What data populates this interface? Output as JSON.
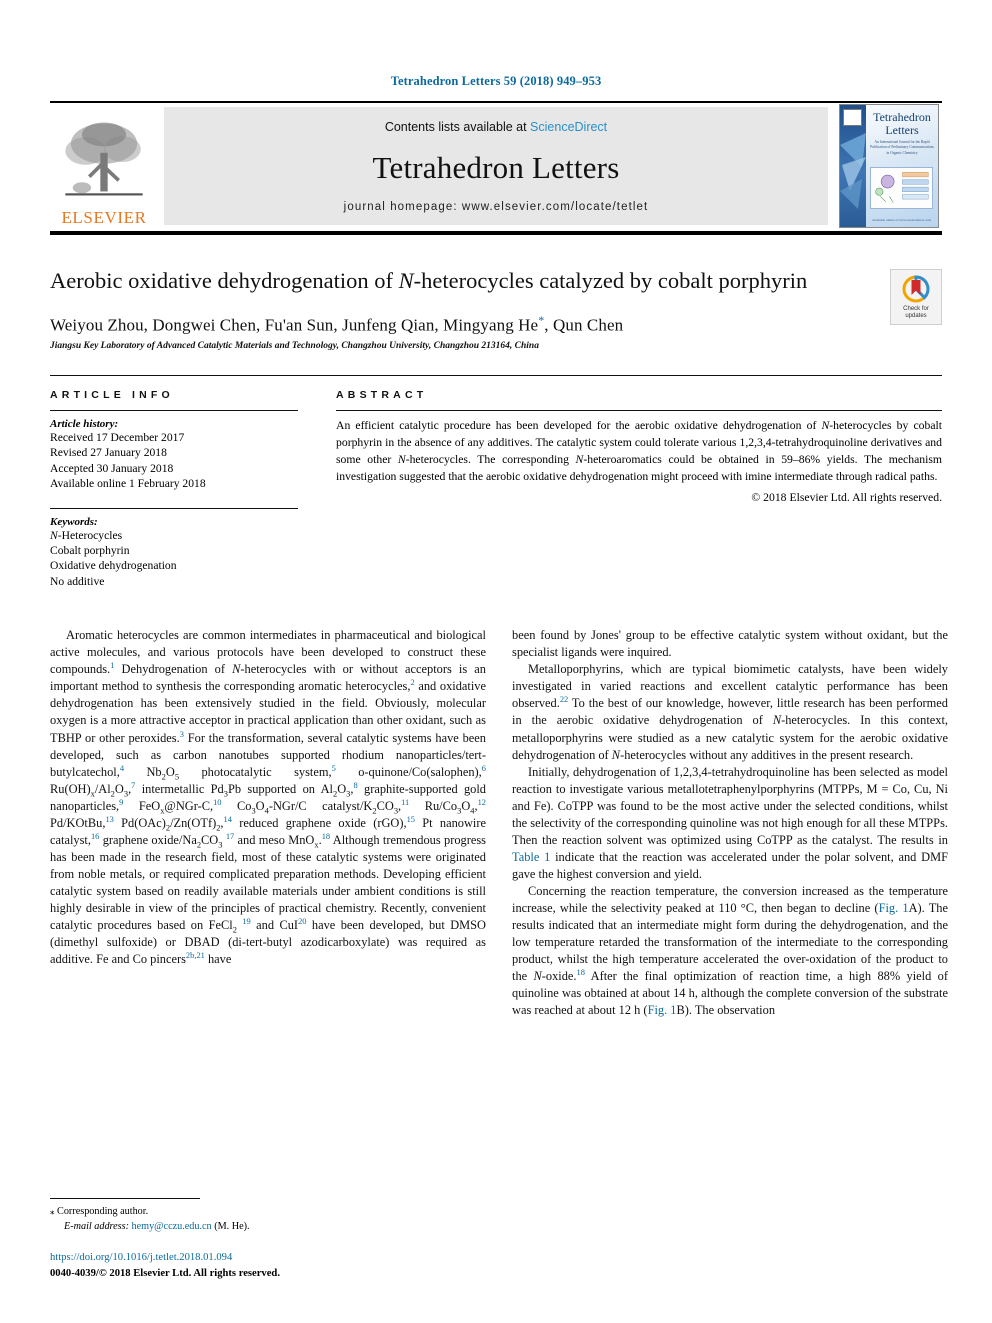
{
  "running_head": "Tetrahedron Letters 59 (2018) 949–953",
  "masthead": {
    "contents_prefix": "Contents lists available at ",
    "contents_link": "ScienceDirect",
    "journal_name": "Tetrahedron Letters",
    "homepage": "journal homepage: www.elsevier.com/locate/tetlet",
    "publisher": "ELSEVIER",
    "cover_title": "Tetrahedron Letters",
    "cover_subtitle": "An International Journal for the Rapid Publication of Preliminary Communications in Organic Chemistry",
    "cover_footer": "Available online at www.sciencedirect.com"
  },
  "article": {
    "title_part1": "Aerobic oxidative dehydrogenation of ",
    "title_italic": "N",
    "title_part2": "-heterocycles catalyzed by cobalt porphyrin",
    "authors": "Weiyou Zhou, Dongwei Chen, Fu'an Sun, Junfeng Qian, Mingyang He",
    "authors_tail": ", Qun Chen",
    "corresponding_marker": "*",
    "affiliation": "Jiangsu Key Laboratory of Advanced Catalytic Materials and Technology, Changzhou University, Changzhou 213164, China",
    "crossmark_line1": "Check for",
    "crossmark_line2": "updates"
  },
  "info": {
    "heading": "ARTICLE INFO",
    "history_label": "Article history:",
    "history": [
      "Received 17 December 2017",
      "Revised 27 January 2018",
      "Accepted 30 January 2018",
      "Available online 1 February 2018"
    ],
    "keywords_label": "Keywords:",
    "keywords": [
      "N-Heterocycles",
      "Cobalt porphyrin",
      "Oxidative dehydrogenation",
      "No additive"
    ]
  },
  "abstract": {
    "heading": "ABSTRACT",
    "text_1": "An efficient catalytic procedure has been developed for the aerobic oxidative dehydrogenation of ",
    "text_italic_1": "N",
    "text_2": "-heterocycles by cobalt porphyrin in the absence of any additives. The catalytic system could tolerate various 1,2,3,4-tetrahydroquinoline derivatives and some other ",
    "text_italic_2": "N",
    "text_3": "-heterocycles. The corresponding ",
    "text_italic_3": "N",
    "text_4": "-heteroaromatics could be obtained in 59–86% yields. The mechanism investigation suggested that the aerobic oxidative dehydrogenation might proceed with imine intermediate through radical paths.",
    "copyright": "© 2018 Elsevier Ltd. All rights reserved."
  },
  "body": {
    "left_col": [
      "Aromatic heterocycles are common intermediates in pharmaceutical and biological active molecules, and various protocols have been developed to construct these compounds.¹ Dehydrogenation of N-heterocycles with or without acceptors is an important method to synthesis the corresponding aromatic heterocycles,² and oxidative dehydrogenation has been extensively studied in the field. Obviously, molecular oxygen is a more attractive acceptor in practical application than other oxidant, such as TBHP or other peroxides.³ For the transformation, several catalytic systems have been developed, such as carbon nanotubes supported rhodium nanoparticles/tert-butylcatechol,⁴ Nb2O5 photocatalytic system,⁵ o-quinone/Co(salophen),⁶ Ru(OH)x/Al2O3,⁷ intermetallic Pd3Pb supported on Al2O3,⁸ graphite-supported gold nanoparticles,⁹ FeOx@NGr-C,¹⁰ Co3O4-NGr/C catalyst/K2CO3,¹¹ Ru/Co3O4,¹² Pd/KOtBu,¹³ Pd(OAc)2/Zn(OTf)2,¹⁴ reduced graphene oxide (rGO),¹⁵ Pt nanowire catalyst,¹⁶ graphene oxide/Na2CO3 ¹⁷ and meso MnOx.¹⁸ Although tremendous progress has been made in the research field, most of these catalytic systems were originated from noble metals, or required complicated preparation methods. Developing efficient catalytic system based on readily available materials under ambient conditions is still highly desirable in view of the principles of practical chemistry. Recently, convenient catalytic procedures based on FeCl2 ¹⁹ and CuI²⁰ have been developed, but DMSO (dimethyl sulfoxide) or DBAD (di-tert-butyl azodicarboxylate) was required as additive. Fe and Co pincers2b,21 have"
    ],
    "right_col": [
      "been found by Jones' group to be effective catalytic system without oxidant, but the specialist ligands were inquired.",
      "Metalloporphyrins, which are typical biomimetic catalysts, have been widely investigated in varied reactions and excellent catalytic performance has been observed.²² To the best of our knowledge, however, little research has been performed in the aerobic oxidative dehydrogenation of N-heterocycles. In this context, metalloporphyrins were studied as a new catalytic system for the aerobic oxidative dehydrogenation of N-heterocycles without any additives in the present research.",
      "Initially, dehydrogenation of 1,2,3,4-tetrahydroquinoline has been selected as model reaction to investigate various metallotetraphenylporphyrins (MTPPs, M = Co, Cu, Ni and Fe). CoTPP was found to be the most active under the selected conditions, whilst the selectivity of the corresponding quinoline was not high enough for all these MTPPs. Then the reaction solvent was optimized using CoTPP as the catalyst. The results in Table 1 indicate that the reaction was accelerated under the polar solvent, and DMF gave the highest conversion and yield.",
      "Concerning the reaction temperature, the conversion increased as the temperature increase, while the selectivity peaked at 110 °C, then began to decline (Fig. 1A). The results indicated that an intermediate might form during the dehydrogenation, and the low temperature retarded the transformation of the intermediate to the corresponding product, whilst the high temperature accelerated the over-oxidation of the product to the N-oxide.¹⁸ After the final optimization of reaction time, a high 88% yield of quinoline was obtained at about 14 h, although the complete conversion of the substrate was reached at about 12 h (Fig. 1B). The observation"
    ]
  },
  "footnote": {
    "corresponding_marker": "⁎",
    "corresponding_text": "Corresponding author.",
    "email_label": "E-mail address:",
    "email": "hemy@cczu.edu.cn",
    "email_suffix": "(M. He).",
    "doi": "https://doi.org/10.1016/j.tetlet.2018.01.094",
    "issn": "0040-4039/© 2018 Elsevier Ltd. All rights reserved."
  },
  "colors": {
    "link": "#0b6a9c",
    "elsevier_orange": "#E87722",
    "sciencedirect_blue": "#2b8fc9",
    "masthead_grey": "#e7e7e7"
  }
}
